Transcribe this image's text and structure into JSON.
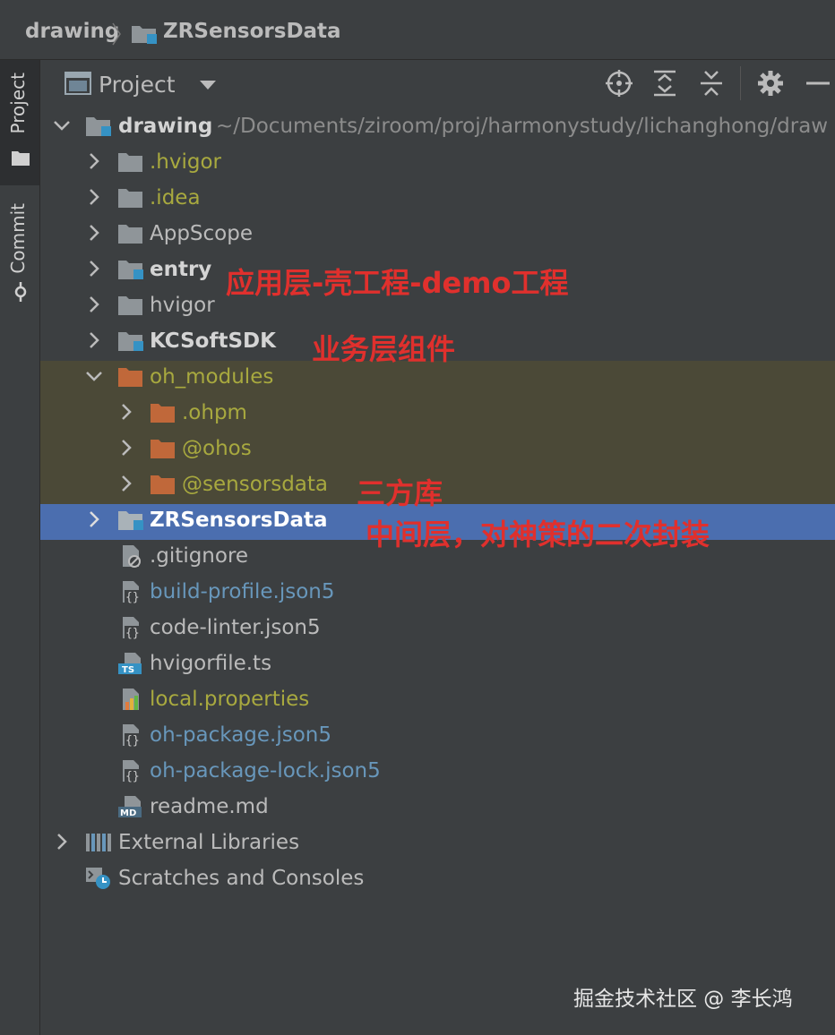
{
  "breadcrumb": {
    "root": "drawing",
    "module": "ZRSensorsData"
  },
  "sidebar": {
    "project_tab": "Project",
    "commit_tab": "Commit"
  },
  "panel": {
    "title": "Project"
  },
  "tree": {
    "root_name": "drawing",
    "root_path": "~/Documents/ziroom/proj/harmonystudy/lichanghong/draw",
    "items": [
      {
        "label": ".hvigor",
        "color": "#a8a93f"
      },
      {
        "label": ".idea",
        "color": "#a8a93f"
      },
      {
        "label": "AppScope",
        "color": "#bbbbbb"
      },
      {
        "label": "entry",
        "color": "#d4d4d4"
      },
      {
        "label": "hvigor",
        "color": "#bbbbbb"
      },
      {
        "label": "KCSoftSDK",
        "color": "#d4d4d4"
      },
      {
        "label": "oh_modules",
        "color": "#a8a93f"
      },
      {
        "label": ".ohpm",
        "color": "#a8a93f"
      },
      {
        "label": "@ohos",
        "color": "#a8a93f"
      },
      {
        "label": "@sensorsdata",
        "color": "#a8a93f"
      },
      {
        "label": "ZRSensorsData",
        "color": "#ffffff"
      },
      {
        "label": ".gitignore",
        "color": "#bbbbbb"
      },
      {
        "label": "build-profile.json5",
        "color": "#6897bb"
      },
      {
        "label": "code-linter.json5",
        "color": "#bbbbbb"
      },
      {
        "label": "hvigorfile.ts",
        "color": "#bbbbbb"
      },
      {
        "label": "local.properties",
        "color": "#a8a93f"
      },
      {
        "label": "oh-package.json5",
        "color": "#6897bb"
      },
      {
        "label": "oh-package-lock.json5",
        "color": "#6897bb"
      },
      {
        "label": "readme.md",
        "color": "#bbbbbb"
      }
    ],
    "external_libraries": "External Libraries",
    "scratches": "Scratches and Consoles"
  },
  "annotations": {
    "entry": "应用层-壳工程-demo工程",
    "kcsoftsdk": "业务层组件",
    "third_party": "三方库",
    "zrsensors": "中间层，对神策的二次封装"
  },
  "badges": {
    "ts": "TS",
    "md": "MD",
    "json": "{}"
  },
  "watermark": "掘金技术社区 @ 李长鸿",
  "colors": {
    "accent_selection": "#4b6eaf",
    "annotation_red": "#e0302d",
    "excluded_bg": "#4b4937"
  }
}
